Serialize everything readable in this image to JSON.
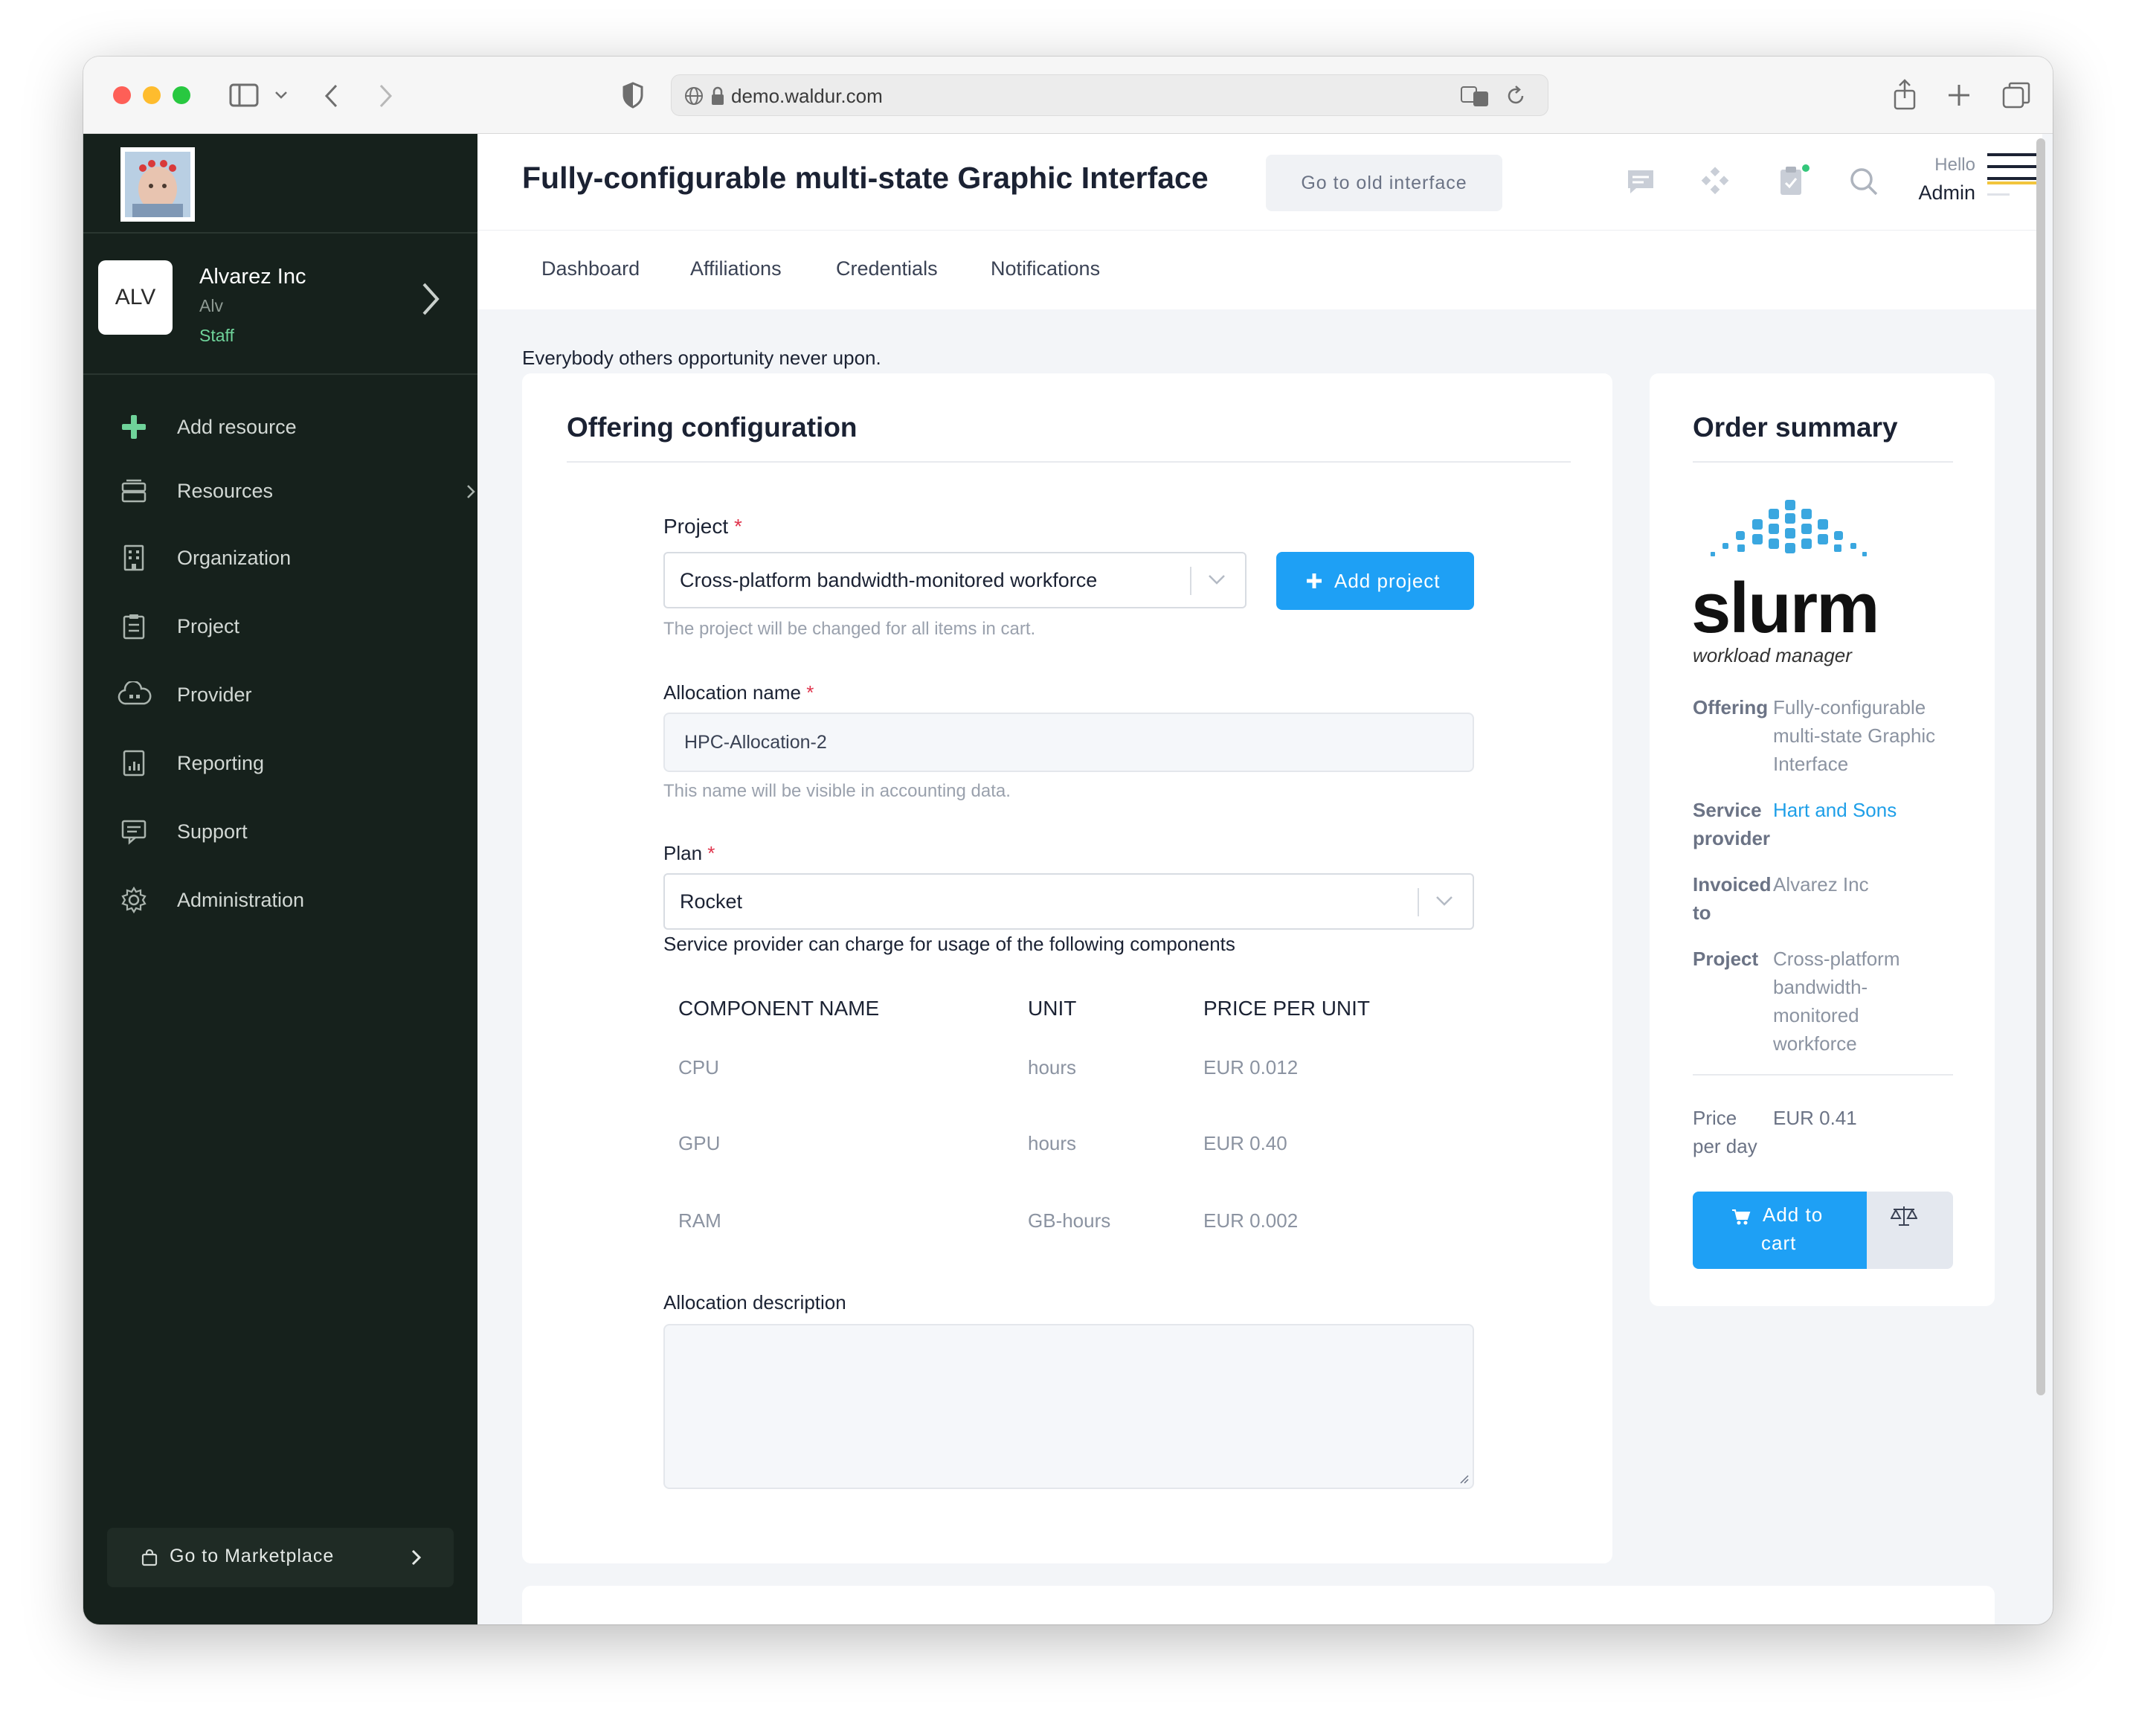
{
  "browser": {
    "url": "demo.waldur.com"
  },
  "sidebar": {
    "org": {
      "badge": "ALV",
      "name": "Alvarez Inc",
      "abbr": "Alv",
      "role": "Staff"
    },
    "items": [
      {
        "label": "Add resource",
        "icon": "plus-icon"
      },
      {
        "label": "Resources",
        "icon": "server-icon"
      },
      {
        "label": "Organization",
        "icon": "building-icon"
      },
      {
        "label": "Project",
        "icon": "clipboard-icon"
      },
      {
        "label": "Provider",
        "icon": "cloud-icon"
      },
      {
        "label": "Reporting",
        "icon": "report-icon"
      },
      {
        "label": "Support",
        "icon": "support-icon"
      },
      {
        "label": "Administration",
        "icon": "gear-icon"
      }
    ],
    "marketplace_label": "Go to Marketplace"
  },
  "header": {
    "title": "Fully-configurable multi-state Graphic Interface",
    "old_interface": "Go to old interface",
    "hello": "Hello",
    "user": "Admin"
  },
  "tabs": [
    {
      "label": "Dashboard"
    },
    {
      "label": "Affiliations"
    },
    {
      "label": "Credentials"
    },
    {
      "label": "Notifications"
    }
  ],
  "intro_text": "Everybody others opportunity never upon.",
  "config": {
    "title": "Offering configuration",
    "project": {
      "label": "Project",
      "required": "*",
      "value": "Cross-platform bandwidth-monitored workforce",
      "help": "The project will be changed for all items in cart.",
      "add_button": "Add project"
    },
    "allocation": {
      "label": "Allocation name",
      "required": "*",
      "value": "HPC-Allocation-2",
      "help": "This name will be visible in accounting data."
    },
    "plan": {
      "label": "Plan",
      "required": "*",
      "value": "Rocket",
      "note": "Service provider can charge for usage of the following components"
    },
    "components": {
      "headers": [
        "COMPONENT NAME",
        "UNIT",
        "PRICE PER UNIT"
      ],
      "rows": [
        [
          "CPU",
          "hours",
          "EUR 0.012"
        ],
        [
          "GPU",
          "hours",
          "EUR 0.40"
        ],
        [
          "RAM",
          "GB-hours",
          "EUR 0.002"
        ]
      ]
    },
    "description_label": "Allocation description"
  },
  "summary": {
    "title": "Order summary",
    "logo_word": "slurm",
    "logo_sub": "workload manager",
    "offering_key": "Offering",
    "offering_val": [
      "Fully-configurable",
      "multi-state Graphic",
      "Interface"
    ],
    "provider_key": [
      "Service",
      "provider"
    ],
    "provider_val": "Hart and Sons",
    "invoiced_key": [
      "Invoiced",
      "to"
    ],
    "invoiced_val": "Alvarez Inc",
    "project_key": "Project",
    "project_val": [
      "Cross-platform",
      "bandwidth-",
      "monitored",
      "workforce"
    ],
    "price_key": [
      "Price",
      "per day"
    ],
    "price_val": "EUR 0.41",
    "add_to_cart": [
      "Add to",
      "cart"
    ]
  },
  "colors": {
    "sidebar_bg": "#16211c",
    "primary": "#1ea0f5",
    "staff_green": "#6fd39a",
    "link": "#1e9fe8"
  }
}
